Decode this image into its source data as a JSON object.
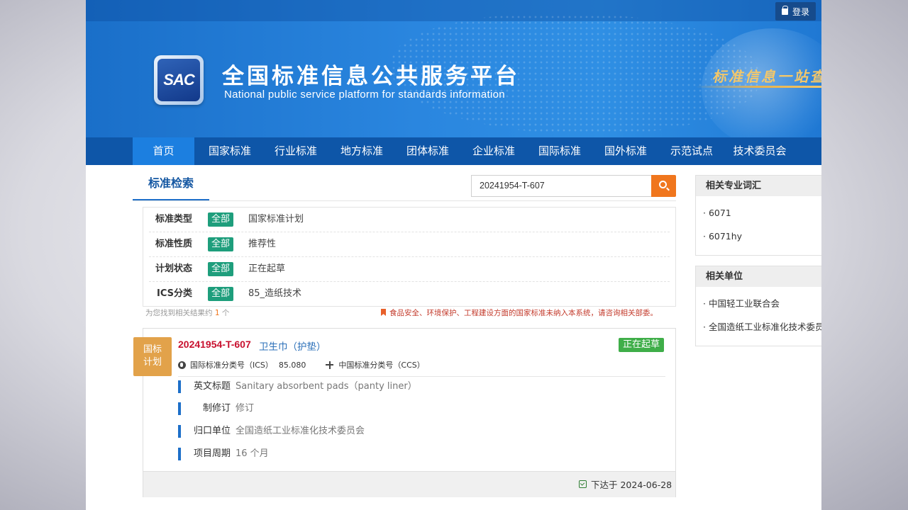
{
  "header": {
    "login_label": "登录",
    "logo_text": "SAC",
    "title": "全国标准信息公共服务平台",
    "subtitle": "National public service platform  for standards information",
    "slogan": "标准信息一站查"
  },
  "nav": {
    "items": [
      {
        "label": "首页"
      },
      {
        "label": "国家标准"
      },
      {
        "label": "行业标准"
      },
      {
        "label": "地方标准"
      },
      {
        "label": "团体标准"
      },
      {
        "label": "企业标准"
      },
      {
        "label": "国际标准"
      },
      {
        "label": "国外标准"
      },
      {
        "label": "示范试点"
      },
      {
        "label": "技术委员会"
      }
    ]
  },
  "search": {
    "tab_label": "标准检索",
    "value": "20241954-T-607"
  },
  "filters": [
    {
      "label": "标准类型",
      "badge": "全部",
      "value": "国家标准计划"
    },
    {
      "label": "标准性质",
      "badge": "全部",
      "value": "推荐性"
    },
    {
      "label": "计划状态",
      "badge": "全部",
      "value": "正在起草"
    },
    {
      "label": "ICS分类",
      "badge": "全部",
      "value": "85_造纸技术"
    }
  ],
  "results_info": {
    "prefix": "为您找到相关结果约",
    "count": "1",
    "suffix": "个",
    "notice": "食品安全、环境保护、工程建设方面的国家标准未纳入本系统，请咨询相关部委。"
  },
  "result": {
    "tag_line1": "国标",
    "tag_line2": "计划",
    "code": "20241954-T-607",
    "name": "卫生巾（护垫）",
    "status": "正在起草",
    "ics_label": "国际标准分类号（ICS）",
    "ics_value": "85.080",
    "ccs_label": "中国标准分类号（CCS）",
    "details": [
      {
        "label": "英文标题",
        "value": "Sanitary absorbent pads（panty liner）"
      },
      {
        "label": "制修订",
        "value": "修订"
      },
      {
        "label": "归口单位",
        "value": "全国造纸工业标准化技术委员会"
      },
      {
        "label": "项目周期",
        "value": "16 个月"
      }
    ],
    "issued": "下达于 2024-06-28"
  },
  "sidebar": {
    "terms_title": "相关专业词汇",
    "terms": [
      "· 6071",
      "· 6071hy"
    ],
    "units_title": "相关单位",
    "units": [
      "· 中国轻工业联合会",
      "· 全国造纸工业标准化技术委员会"
    ]
  }
}
